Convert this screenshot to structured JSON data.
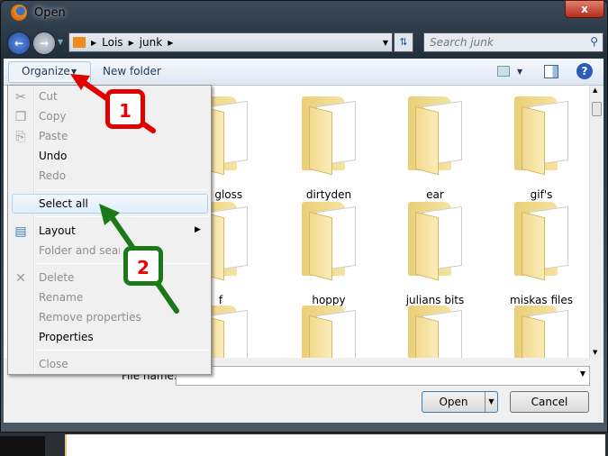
{
  "window": {
    "title": "Open",
    "close": "x"
  },
  "address": {
    "path": [
      "Lois",
      "junk"
    ],
    "search_placeholder": "Search junk"
  },
  "toolbar": {
    "organize": "Organize",
    "new_folder": "New folder"
  },
  "folders": [
    {
      "label": "es gloss"
    },
    {
      "label": "dirtyden"
    },
    {
      "label": "ear"
    },
    {
      "label": "gif's"
    },
    {
      "label": "f"
    },
    {
      "label": "hoppy"
    },
    {
      "label": "julians bits"
    },
    {
      "label": "miskas files"
    },
    {
      "label": ""
    },
    {
      "label": ""
    },
    {
      "label": ""
    },
    {
      "label": ""
    }
  ],
  "menu": {
    "items": [
      {
        "label": "Cut",
        "enabled": false,
        "icon": "scissors-icon"
      },
      {
        "label": "Copy",
        "enabled": false,
        "icon": "copy-icon"
      },
      {
        "label": "Paste",
        "enabled": false,
        "icon": "clipboard-icon"
      },
      {
        "label": "Undo",
        "enabled": true
      },
      {
        "label": "Redo",
        "enabled": false
      },
      {
        "label": "Select all",
        "enabled": true,
        "highlighted": true
      },
      {
        "label": "Layout",
        "enabled": true,
        "icon": "layout-icon",
        "submenu": true
      },
      {
        "label": "Folder and search options",
        "enabled": false
      },
      {
        "label": "Delete",
        "enabled": false,
        "icon": "delete-icon"
      },
      {
        "label": "Rename",
        "enabled": false
      },
      {
        "label": "Remove properties",
        "enabled": false
      },
      {
        "label": "Properties",
        "enabled": true
      },
      {
        "label": "Close",
        "enabled": false
      }
    ]
  },
  "annotations": [
    {
      "label": "1",
      "color": "#e00000"
    },
    {
      "label": "2",
      "color": "#1a7a1a"
    }
  ],
  "footer": {
    "file_name_label": "File name:",
    "file_name_value": "",
    "open": "Open",
    "cancel": "Cancel"
  }
}
